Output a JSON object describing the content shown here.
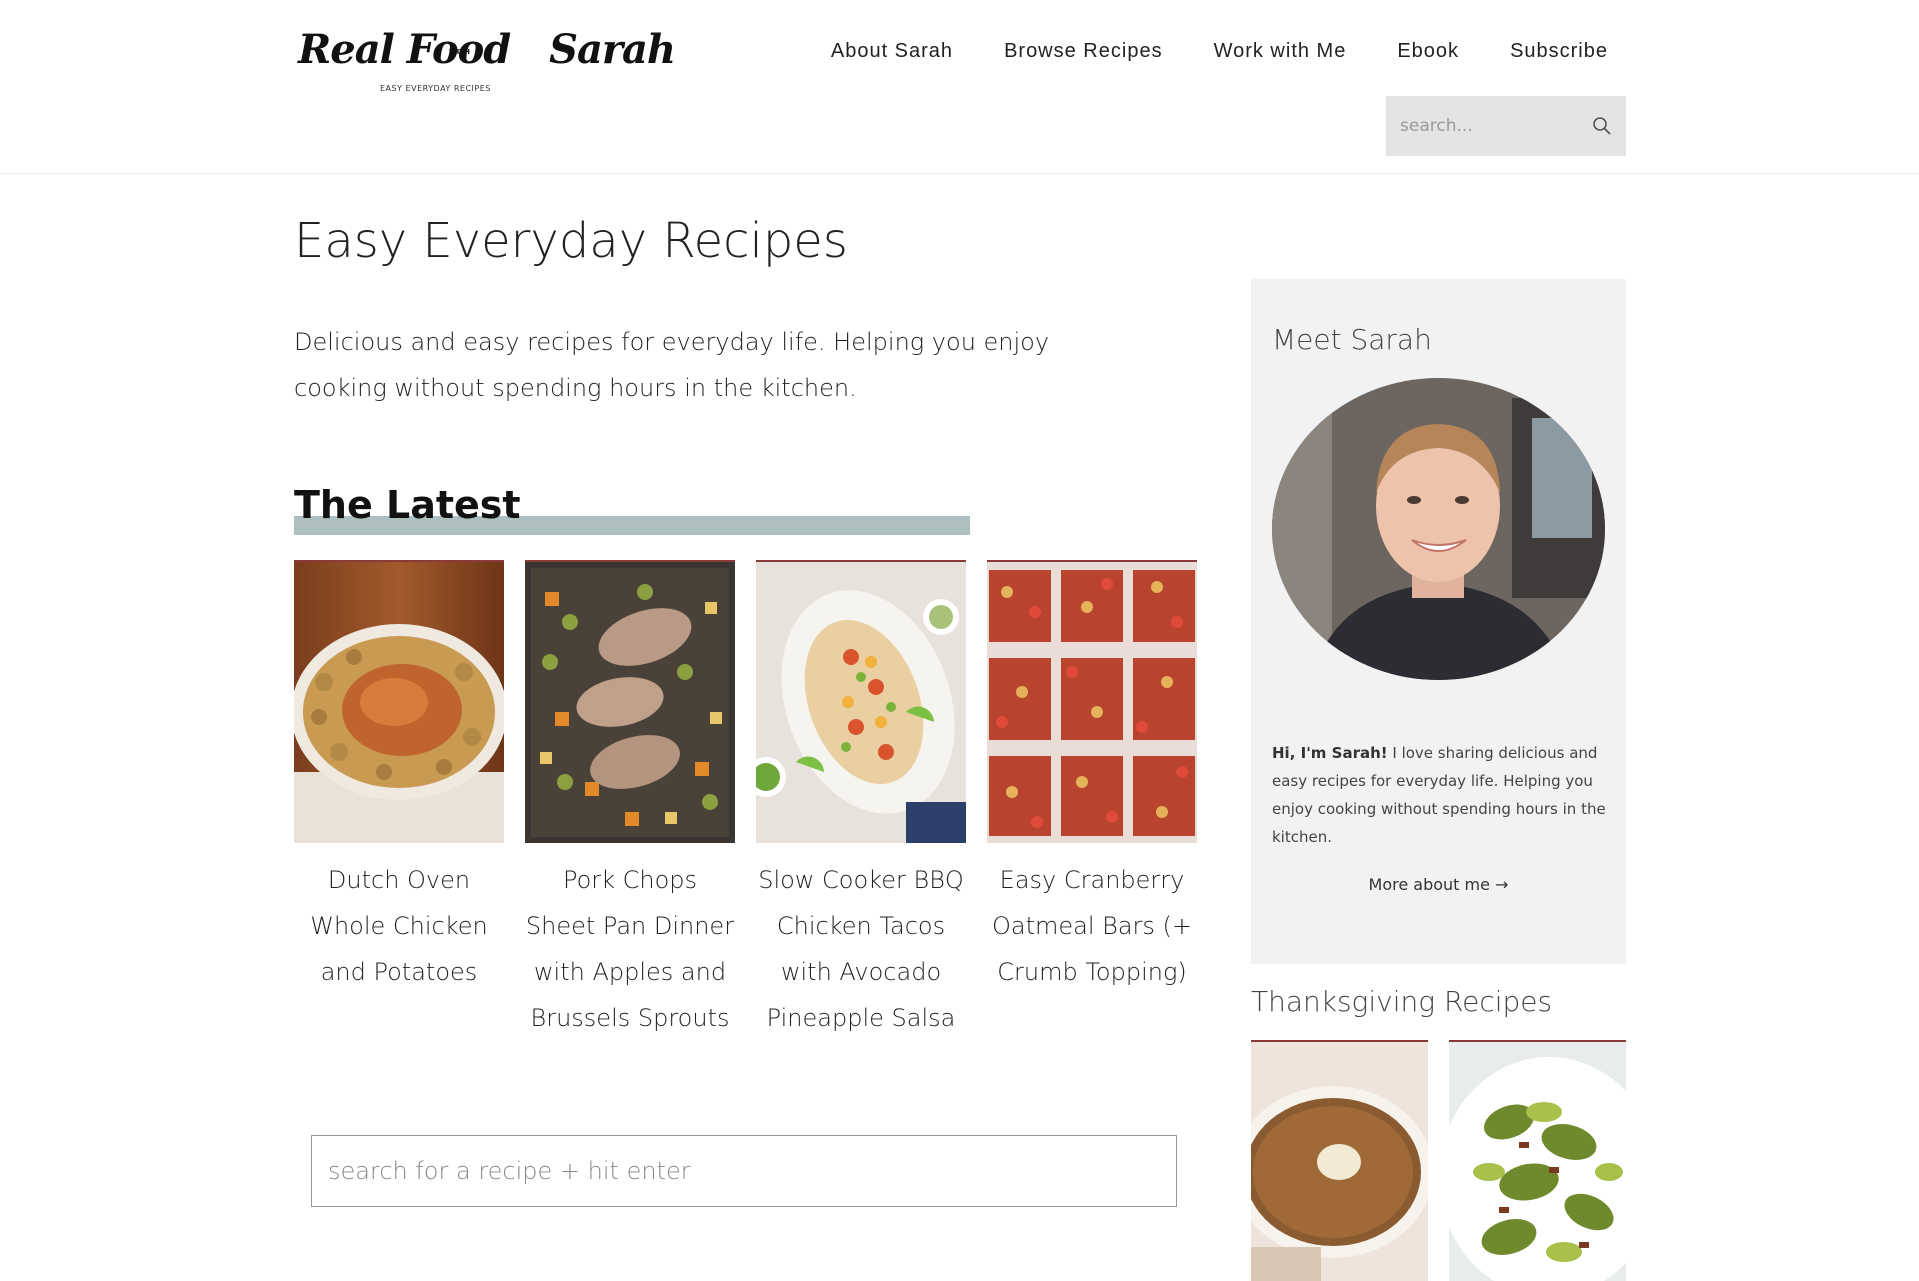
{
  "site": {
    "logo_text": "Real Food",
    "logo_with": "WITH",
    "logo_name": "Sarah",
    "logo_tagline": "EASY EVERYDAY RECIPES"
  },
  "nav": {
    "items": [
      {
        "label": "About Sarah"
      },
      {
        "label": "Browse Recipes"
      },
      {
        "label": "Work with Me"
      },
      {
        "label": "Ebook"
      },
      {
        "label": "Subscribe"
      }
    ]
  },
  "header_search": {
    "placeholder": "search..."
  },
  "main": {
    "title": "Easy Everyday Recipes",
    "intro": "Delicious and easy recipes for everyday life. Helping you enjoy cooking without spending hours in the kitchen.",
    "latest_heading": "The Latest",
    "recipes": [
      {
        "title": "Dutch Oven Whole Chicken and Potatoes"
      },
      {
        "title": "Pork Chops Sheet Pan Dinner with Apples and Brussels Sprouts"
      },
      {
        "title": "Slow Cooker BBQ Chicken Tacos with Avocado Pineapple Salsa"
      },
      {
        "title": "Easy Cranberry Oatmeal Bars (+ Crumb Topping)"
      }
    ],
    "recipe_search_placeholder": "search for a recipe + hit enter"
  },
  "sidebar": {
    "meet_title": "Meet Sarah",
    "bio_bold": "Hi, I'm Sarah!",
    "bio_rest": " I love sharing delicious and easy recipes for everyday life. Helping you enjoy cooking without spending hours in the kitchen.",
    "more_link": "More about me →",
    "thanksgiving_title": "Thanksgiving Recipes"
  },
  "colors": {
    "accent_bar": "#aebfbf",
    "card_border": "#8b3a3a",
    "sidebar_bg": "#f2f2f2",
    "search_bg": "#e4e4e4"
  }
}
